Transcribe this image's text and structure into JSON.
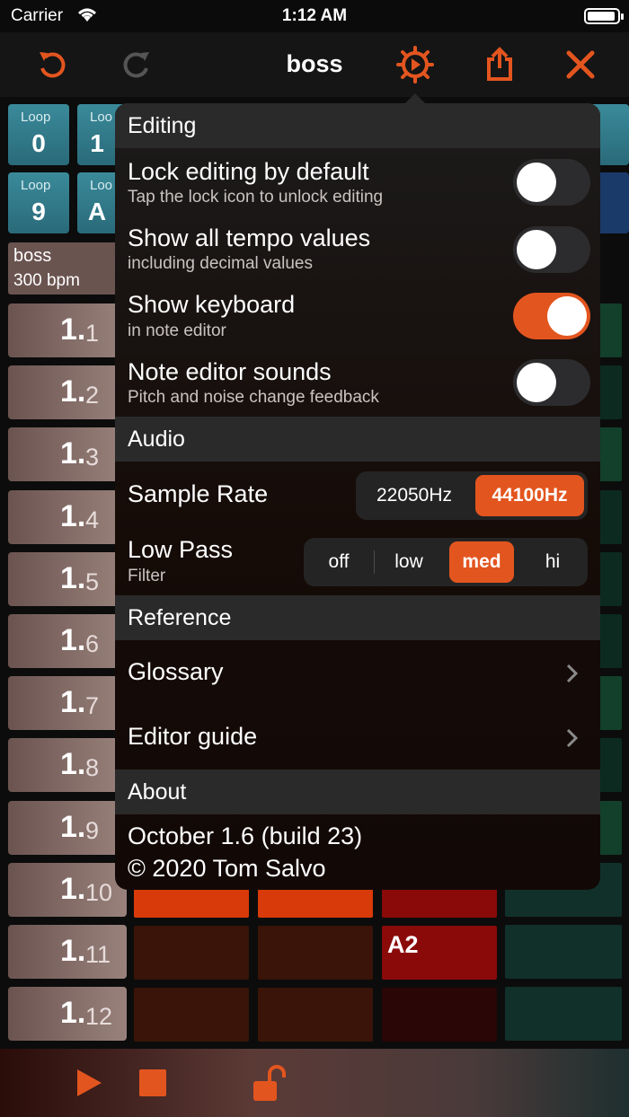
{
  "status_bar": {
    "carrier": "Carrier",
    "time": "1:12 AM"
  },
  "nav": {
    "title": "boss"
  },
  "colors": {
    "accent": "#e3551f",
    "loop_tile": "#3a8a9a",
    "note_red": "#8a0a0a",
    "note_orange": "#d83a0a"
  },
  "loops": [
    {
      "label": "Loop",
      "number": "0"
    },
    {
      "label": "Loo",
      "number": "1"
    },
    {
      "label": "Loop",
      "number": "9"
    },
    {
      "label": "Loo",
      "number": "A"
    }
  ],
  "track": {
    "name": "boss",
    "tempo": "300 bpm"
  },
  "steps": [
    {
      "major": "1.",
      "minor": "1"
    },
    {
      "major": "1.",
      "minor": "2"
    },
    {
      "major": "1.",
      "minor": "3"
    },
    {
      "major": "1.",
      "minor": "4"
    },
    {
      "major": "1.",
      "minor": "5"
    },
    {
      "major": "1.",
      "minor": "6"
    },
    {
      "major": "1.",
      "minor": "7"
    },
    {
      "major": "1.",
      "minor": "8"
    },
    {
      "major": "1.",
      "minor": "9"
    },
    {
      "major": "1.",
      "minor": "10"
    },
    {
      "major": "1.",
      "minor": "11"
    },
    {
      "major": "1.",
      "minor": "12"
    }
  ],
  "notes": {
    "row11_col3": "A2"
  },
  "settings": {
    "editing": {
      "header": "Editing",
      "lock_editing": {
        "title": "Lock editing by default",
        "subtitle": "Tap the lock icon to unlock editing",
        "on": false
      },
      "tempo_values": {
        "title": "Show all tempo values",
        "subtitle": "including decimal values",
        "on": false
      },
      "keyboard": {
        "title": "Show keyboard",
        "subtitle": "in note editor",
        "on": true
      },
      "sounds": {
        "title": "Note editor sounds",
        "subtitle": "Pitch and noise change feedback",
        "on": false
      }
    },
    "audio": {
      "header": "Audio",
      "sample_rate": {
        "title": "Sample Rate",
        "options": [
          "22050Hz",
          "44100Hz"
        ],
        "selected": "44100Hz"
      },
      "low_pass": {
        "title": "Low Pass",
        "subtitle": "Filter",
        "options": [
          "off",
          "low",
          "med",
          "hi"
        ],
        "selected": "med"
      }
    },
    "reference": {
      "header": "Reference",
      "glossary": "Glossary",
      "editor_guide": "Editor guide"
    },
    "about": {
      "header": "About",
      "version": "October 1.6 (build 23)",
      "copyright": "© 2020 Tom Salvo"
    }
  }
}
